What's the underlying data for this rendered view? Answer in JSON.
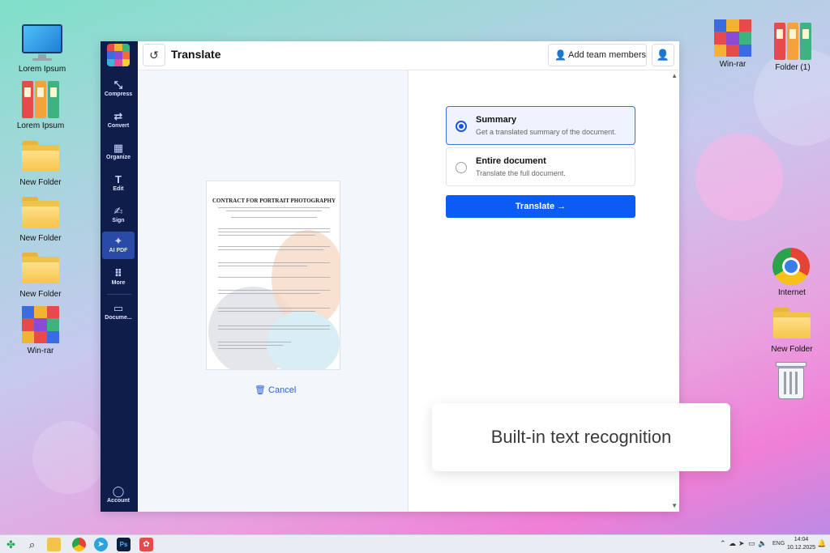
{
  "desktop": {
    "left_icons": [
      {
        "label": "Lorem Ipsum",
        "icon": "monitor-icon"
      },
      {
        "label": "Lorem Ipsum",
        "icon": "binders-icon"
      },
      {
        "label": "New Folder",
        "icon": "folder-icon"
      },
      {
        "label": "New Folder",
        "icon": "folder-icon"
      },
      {
        "label": "New Folder",
        "icon": "folder-icon"
      },
      {
        "label": "Win-rar",
        "icon": "winrar-icon"
      }
    ],
    "right_icons": [
      {
        "label": "Win-rar",
        "icon": "winrar-icon"
      },
      {
        "label": "Folder (1)",
        "icon": "binders-icon"
      },
      {
        "label": "Internet",
        "icon": "chrome-icon"
      },
      {
        "label": "New Folder",
        "icon": "folder-icon"
      },
      {
        "label": "",
        "icon": "recycle-bin-icon"
      }
    ]
  },
  "app": {
    "title": "Translate",
    "add_team_label": "Add team members",
    "sidebar": [
      {
        "label": "Compress",
        "icon": "compress-icon"
      },
      {
        "label": "Convert",
        "icon": "convert-icon"
      },
      {
        "label": "Organize",
        "icon": "organize-icon"
      },
      {
        "label": "Edit",
        "icon": "edit-icon"
      },
      {
        "label": "Sign",
        "icon": "sign-icon"
      },
      {
        "label": "AI PDF",
        "icon": "ai-sparkle-icon",
        "active": true
      },
      {
        "label": "More",
        "icon": "grid-icon"
      },
      {
        "label": "Docume...",
        "icon": "folder-icon"
      }
    ],
    "account_label": "Account",
    "document": {
      "title": "CONTRACT FOR PORTRAIT PHOTOGRAPHY"
    },
    "cancel_label": "Cancel",
    "options": [
      {
        "title": "Summary",
        "desc": "Get a translated summary of the document.",
        "selected": true
      },
      {
        "title": "Entire document",
        "desc": "Translate the full document.",
        "selected": false
      }
    ],
    "translate_label": "Translate →"
  },
  "banner": {
    "text": "Built-in text recognition"
  },
  "taskbar": {
    "language": "ENG",
    "time": "14:04",
    "date": "10.12.2025"
  },
  "colors": {
    "accent": "#0b5cf5",
    "sidebar": "#0f1d4a",
    "sidebar_active": "#2a4aa8"
  }
}
